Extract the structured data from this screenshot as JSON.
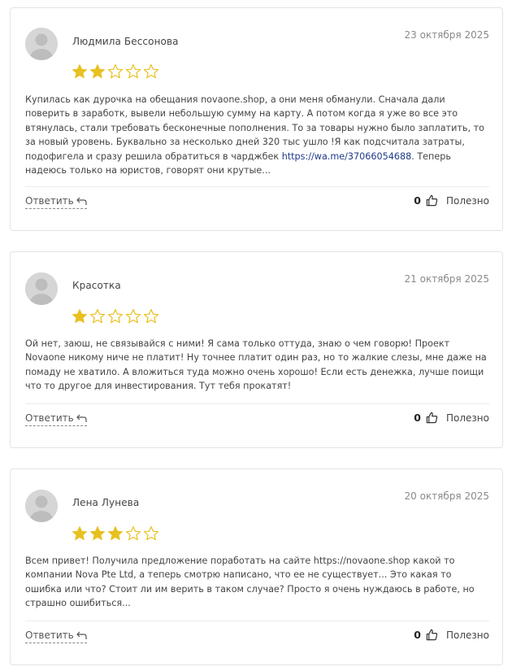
{
  "reviews": [
    {
      "author": "Людмила Бессонова",
      "date": "23 октября 2025",
      "rating": 2,
      "text_before_link": "Купилась как дурочка на обещания novaone.shop, а они меня обманули. Сначала дали поверить в заработк, вывели небольшую сумму на карту. А потом когда я уже во все это втянулась, стали требовать бесконечные пополнения. То за товары нужно было заплатить, то за новый уровень. Буквально за несколько дней 320 тыс ушло !Я как подсчитала затраты, подофигела и сразу решила обратиться в чарджбек ",
      "link": "https://wa.me/37066054688",
      "text_after_link": ". Теперь надеюсь только на юристов, говорят они крутые...",
      "reply_label": "Ответить",
      "helpful_count": "0",
      "helpful_label": "Полезно"
    },
    {
      "author": "Красотка",
      "date": "21 октября 2025",
      "rating": 1,
      "text_before_link": "Ой нет, заюш, не связывайся с ними! Я сама только оттуда, знаю о чем говорю! Проект Novaone никому ниче не платит! Ну точнее платит один раз, но то жалкие слезы, мне даже на помаду не хватило. А вложиться туда можно очень хорошо! Если есть денежка, лучше поищи что то другое для инвестирования. Тут тебя прокатят!",
      "link": "",
      "text_after_link": "",
      "reply_label": "Ответить",
      "helpful_count": "0",
      "helpful_label": "Полезно"
    },
    {
      "author": "Лена Лунева",
      "date": "20 октября 2025",
      "rating": 3,
      "text_before_link": "Всем привет! Получила предложение поработать на сайте https://novaone.shop какой то компании Nova Pte Ltd, а теперь смотрю написано, что ее не существует... Это какая то ошибка или что? Стоит ли им верить в таком случае? Просто я очень нуждаюсь в работе, но страшно ошибиться...",
      "link": "",
      "text_after_link": "",
      "reply_label": "Ответить",
      "helpful_count": "0",
      "helpful_label": "Полезно"
    }
  ],
  "max_rating": 5,
  "colors": {
    "star_filled": "#e8c020",
    "star_empty_stroke": "#e8c020",
    "link": "#1e3a8a",
    "border": "#e3e3e3"
  },
  "icons": {
    "avatar": "user-silhouette-icon",
    "reply": "reply-arrow-icon",
    "helpful": "thumbs-up-icon",
    "star": "star-icon"
  }
}
